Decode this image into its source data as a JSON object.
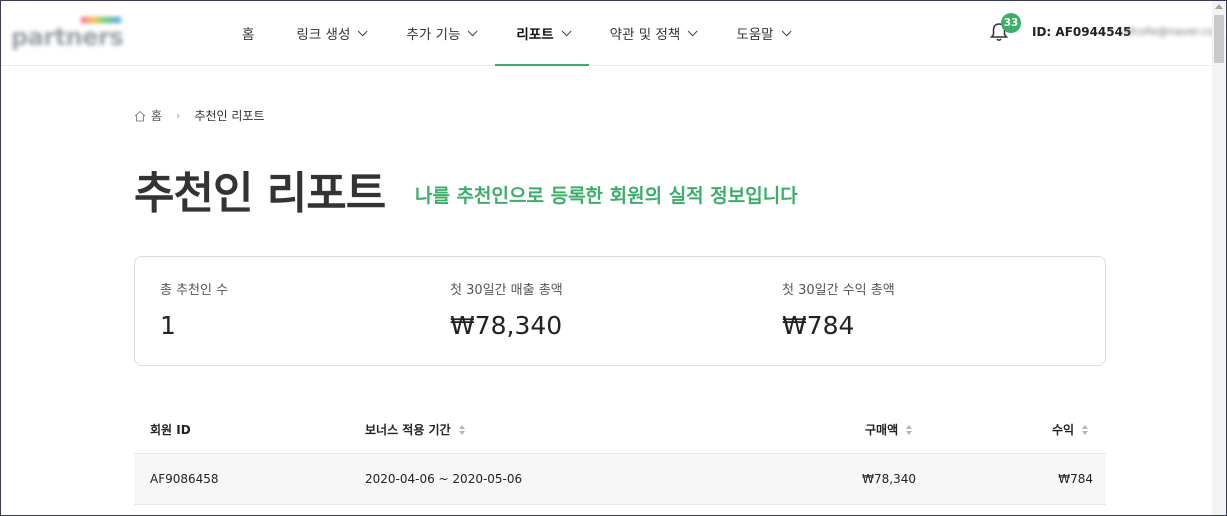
{
  "header": {
    "logo_text": "partners",
    "nav": [
      {
        "label": "홈",
        "dropdown": false
      },
      {
        "label": "링크 생성",
        "dropdown": true
      },
      {
        "label": "추가 기능",
        "dropdown": true
      },
      {
        "label": "리포트",
        "dropdown": true,
        "active": true
      },
      {
        "label": "약관 및 정책",
        "dropdown": true
      },
      {
        "label": "도움말",
        "dropdown": true
      }
    ],
    "notification_count": "33",
    "user_id": "ID: AF0944545",
    "user_email": "afcofe@naver.com"
  },
  "breadcrumb": {
    "home": "홈",
    "current": "추천인 리포트"
  },
  "page": {
    "title": "추천인 리포트",
    "subtitle": "나를 추천인으로 등록한 회원의 실적 정보입니다"
  },
  "summary": [
    {
      "label": "총 추천인 수",
      "value": "1"
    },
    {
      "label": "첫 30일간 매출 총액",
      "value": "₩78,340"
    },
    {
      "label": "첫 30일간 수익 총액",
      "value": "₩784"
    }
  ],
  "table": {
    "columns": [
      "회원 ID",
      "보너스 적용 기간",
      "구매액",
      "수익"
    ],
    "rows": [
      [
        "AF9086458",
        "2020-04-06 ~ 2020-05-06",
        "₩78,340",
        "₩784"
      ]
    ]
  },
  "colors": {
    "accent": "#3cae6a",
    "text": "#333333",
    "row_bg": "#f7f7f7"
  }
}
